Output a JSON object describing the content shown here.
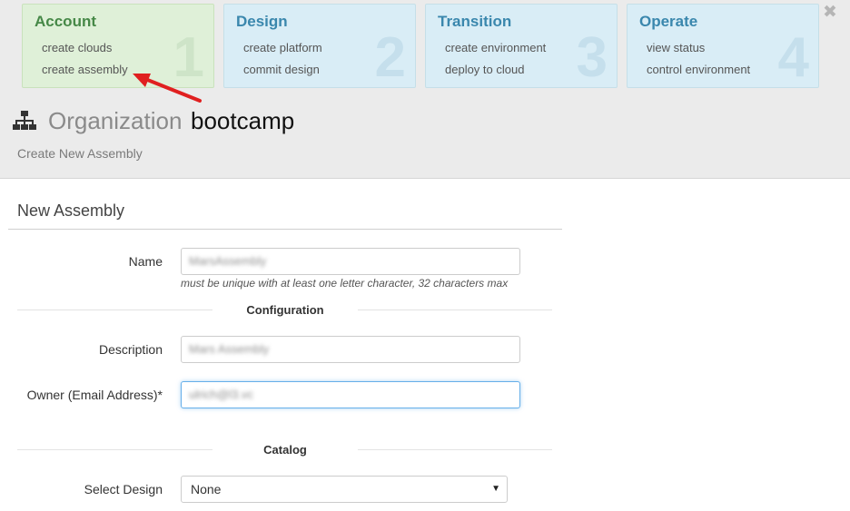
{
  "steps": [
    {
      "title": "Account",
      "links": [
        "create clouds",
        "create assembly"
      ],
      "number": "1",
      "active": true
    },
    {
      "title": "Design",
      "links": [
        "create platform",
        "commit design"
      ],
      "number": "2",
      "active": false
    },
    {
      "title": "Transition",
      "links": [
        "create environment",
        "deploy to cloud"
      ],
      "number": "3",
      "active": false
    },
    {
      "title": "Operate",
      "links": [
        "view status",
        "control environment"
      ],
      "number": "4",
      "active": false
    }
  ],
  "close_glyph": "✖",
  "header": {
    "icon": "sitemap-icon",
    "label": "Organization",
    "org_name": "bootcamp",
    "subtitle": "Create New Assembly"
  },
  "form": {
    "title": "New Assembly",
    "name": {
      "label": "Name",
      "value": "MarsAssembly",
      "help": "must be unique with at least one letter character, 32 characters max"
    },
    "configuration_heading": "Configuration",
    "description": {
      "label": "Description",
      "value": "Mars Assembly"
    },
    "owner": {
      "label": "Owner (Email Address)*",
      "value": "ulrich@l3.vc"
    },
    "catalog_heading": "Catalog",
    "select_design": {
      "label": "Select Design",
      "value": "None",
      "caret": "▼"
    }
  },
  "colors": {
    "active_step_bg": "#dff0d8",
    "step_bg": "#d9edf6",
    "annotation_arrow": "#e02020",
    "focus_border": "#66afe9"
  }
}
